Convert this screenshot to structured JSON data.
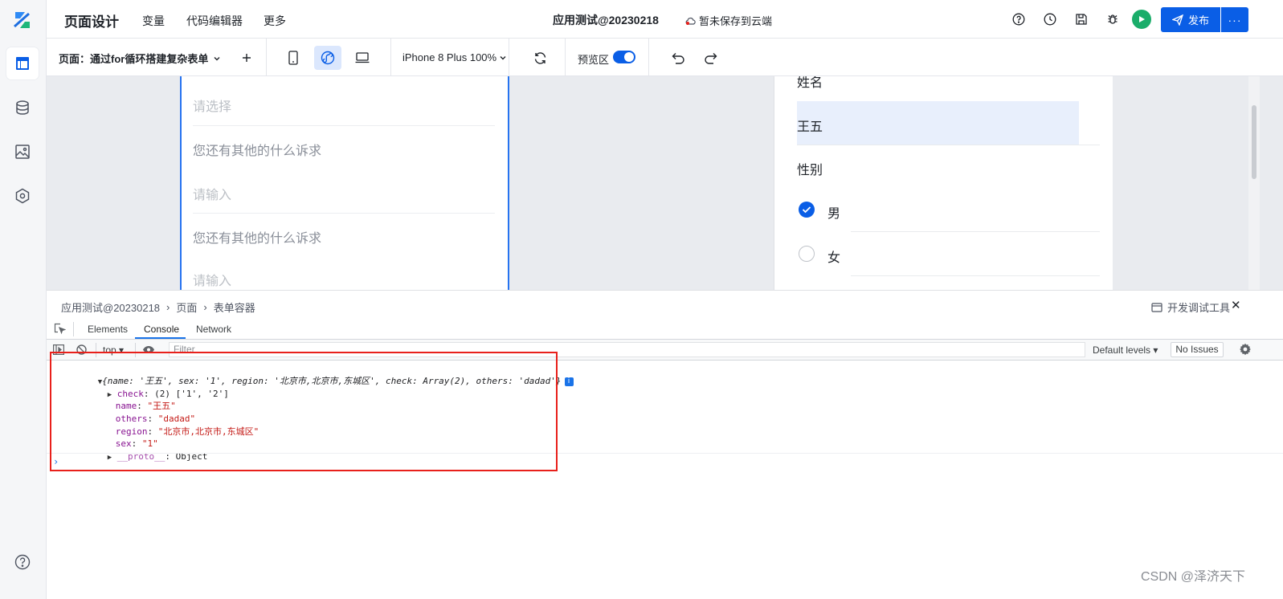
{
  "header": {
    "title": "页面设计",
    "nav": [
      "变量",
      "代码编辑器",
      "更多"
    ],
    "app_title": "应用测试@20230218",
    "save_status": "暂未保存到云端",
    "publish_label": "发布",
    "more_label": "···"
  },
  "toolbar": {
    "page_selector": "页面：通过for循环搭建复杂表单",
    "device": "iPhone 8 Plus 100%",
    "preview_label": "预览区",
    "preview_on": true
  },
  "phone_canvas": {
    "select_placeholder": "请选择",
    "question1": "您还有其他的什么诉求",
    "input1_placeholder": "请输入",
    "question2": "您还有其他的什么诉求",
    "input2_placeholder": "请输入"
  },
  "preview_panel": {
    "name_label": "姓名",
    "name_value": "王五",
    "gender_label": "性别",
    "option_male": "男",
    "option_female": "女",
    "selected": "男"
  },
  "devtools": {
    "breadcrumb": [
      "应用测试@20230218",
      "页面",
      "表单容器"
    ],
    "title": "开发调试工具",
    "tabs": [
      "Elements",
      "Console",
      "Network"
    ],
    "active_tab": "Console",
    "context": "top",
    "filter_placeholder": "Filter",
    "levels": "Default levels",
    "issues": "No Issues",
    "console": {
      "summary": "{name: '王五', sex: '1', region: '北京市,北京市,东城区', check: Array(2), others: 'dadad'}",
      "check": "(2) ['1', '2']",
      "name": "\"王五\"",
      "others": "\"dadad\"",
      "region": "\"北京市,北京市,东城区\"",
      "sex": "\"1\"",
      "proto": "Object"
    }
  },
  "watermark": "CSDN @泽济天下",
  "colors": {
    "primary": "#0a5ee6",
    "run": "#1aad6a",
    "highlight": "#e8201b"
  }
}
